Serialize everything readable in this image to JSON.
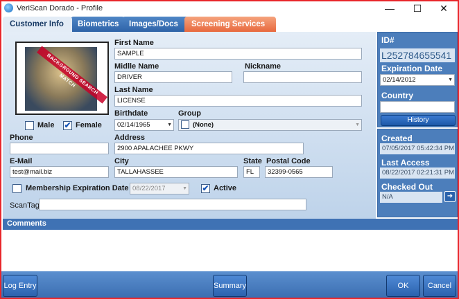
{
  "window": {
    "title": "VeriScan Dorado - Profile",
    "minimize_glyph": "—",
    "maximize_glyph": "☐",
    "close_glyph": "✕"
  },
  "tabs": [
    {
      "label": "Customer Info",
      "active": true
    },
    {
      "label": "Biometrics"
    },
    {
      "label": "Images/Docs"
    },
    {
      "label": "Screening Services"
    }
  ],
  "photo": {
    "banner_text": "BACKGROUND SEARCH MATCH"
  },
  "gender": {
    "male_label": "Male",
    "male_checked": false,
    "female_label": "Female",
    "female_checked": true
  },
  "fields": {
    "first_name": {
      "label": "First Name",
      "value": "SAMPLE"
    },
    "middle_name": {
      "label": "Midlle Name",
      "value": "DRIVER"
    },
    "nickname": {
      "label": "Nickname",
      "value": ""
    },
    "last_name": {
      "label": "Last Name",
      "value": "LICENSE"
    },
    "birthdate": {
      "label": "Birthdate",
      "value": "02/14/1965"
    },
    "group": {
      "label": "Group",
      "value": "(None)"
    },
    "phone": {
      "label": "Phone",
      "value": ""
    },
    "address": {
      "label": "Address",
      "value": "2900 APALACHEE PKWY"
    },
    "email": {
      "label": "E-Mail",
      "value": "test@mail.biz"
    },
    "city": {
      "label": "City",
      "value": "TALLAHASSEE"
    },
    "state": {
      "label": "State",
      "value": "FL"
    },
    "postal_code": {
      "label": "Postal Code",
      "value": "32399-0565"
    },
    "membership_expiration": {
      "label": "Membership Expiration Date",
      "value": "08/22/2017",
      "checked": false
    },
    "active": {
      "label": "Active",
      "checked": true
    },
    "scantag": {
      "label": "ScanTag",
      "value": ""
    }
  },
  "side": {
    "id_label": "ID#",
    "id_value": "L252784655541",
    "expiration_label": "Expiration Date",
    "expiration_value": "02/14/2012",
    "country_label": "Country",
    "country_value": "",
    "history_button": "History",
    "created_label": "Created",
    "created_value": "07/05/2017 05:42:34 PM",
    "last_access_label": "Last Access",
    "last_access_value": "08/22/2017 02:21:31 PM",
    "checked_out_label": "Checked Out",
    "checked_out_value": "N/A"
  },
  "comments": {
    "label": "Comments"
  },
  "footer": {
    "log_entry": "Log Entry",
    "summary": "Summary",
    "ok": "OK",
    "cancel": "Cancel"
  },
  "icons": {
    "dropdown": "▼",
    "check": "✔",
    "exit": "➜"
  }
}
